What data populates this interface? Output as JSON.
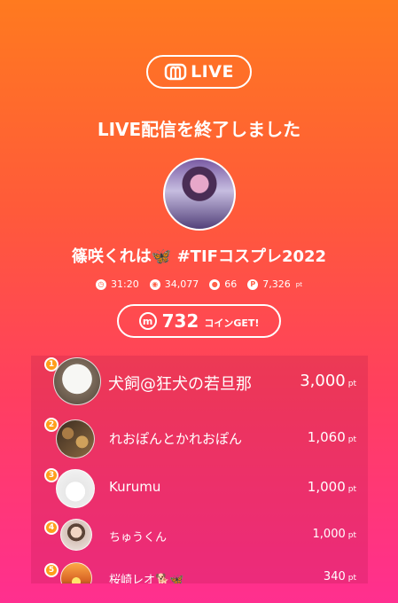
{
  "header": {
    "live_label": "LIVE",
    "headline": "LIVE配信を終了しました"
  },
  "stream": {
    "title": "篠咲くれは🦋 #TIFコスプレ2022",
    "stats": {
      "duration": "31:20",
      "viewers": "34,077",
      "comments": "66",
      "points": "7,326",
      "points_unit": "pt"
    }
  },
  "coins": {
    "value": "732",
    "suffix": "コインGET!"
  },
  "ranking": [
    {
      "rank": "1",
      "name": "犬飼@狂犬の若旦那",
      "points": "3,000",
      "unit": "pt",
      "avatar_icon": "white-dog-icon"
    },
    {
      "rank": "2",
      "name": "れおぽんとかれおぽん",
      "points": "1,060",
      "unit": "pt",
      "avatar_icon": "food-photo-icon"
    },
    {
      "rank": "3",
      "name": "Kurumu",
      "points": "1,000",
      "unit": "pt",
      "avatar_icon": "cartoon-dog-icon"
    },
    {
      "rank": "4",
      "name": "ちゅうくん",
      "points": "1,000",
      "unit": "pt",
      "avatar_icon": "person-photo-icon"
    },
    {
      "rank": "5",
      "name": "桜崎レオ🐕🦋",
      "points": "340",
      "unit": "pt",
      "avatar_icon": "sunset-photo-icon"
    }
  ]
}
